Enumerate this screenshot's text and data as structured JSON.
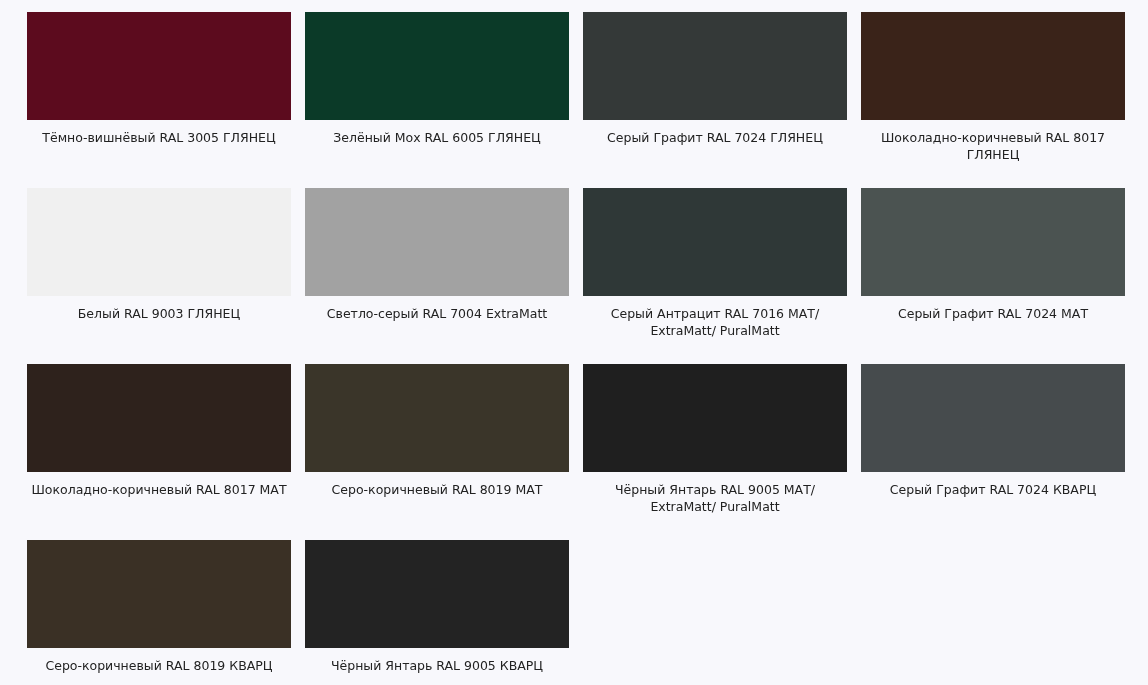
{
  "swatches": [
    {
      "label": "Тёмно-вишнёвый RAL 3005 ГЛЯНЕЦ",
      "color": "#5c0b1e"
    },
    {
      "label": "Зелёный Мох RAL 6005 ГЛЯНЕЦ",
      "color": "#0b3a28"
    },
    {
      "label": "Серый Графит RAL 7024 ГЛЯНЕЦ",
      "color": "#343938"
    },
    {
      "label": "Шоколадно-коричневый RAL 8017 ГЛЯНЕЦ",
      "color": "#3a2319"
    },
    {
      "label": "Белый RAL 9003 ГЛЯНЕЦ",
      "color": "#f0f0f0"
    },
    {
      "label": "Светло-серый RAL 7004 ExtraMatt",
      "color": "#a2a2a2"
    },
    {
      "label": "Серый Антрацит RAL 7016 МАТ/ ExtraMatt/ PuralMatt",
      "color": "#2f3837"
    },
    {
      "label": "Серый Графит RAL 7024 МАТ",
      "color": "#4b5351"
    },
    {
      "label": "Шоколадно-коричневый RAL 8017 МАТ",
      "color": "#2e221c"
    },
    {
      "label": "Серо-коричневый RAL 8019 МАТ",
      "color": "#3a3529"
    },
    {
      "label": "Чёрный Янтарь RAL 9005 МАТ/ ExtraMatt/ PuralMatt",
      "color": "#1f1f1f"
    },
    {
      "label": "Серый Графит RAL 7024 КВАРЦ",
      "color": "#464b4d"
    },
    {
      "label": "Серо-коричневый RAL 8019 КВАРЦ",
      "color": "#3a3025"
    },
    {
      "label": "Чёрный Янтарь RAL 9005 КВАРЦ",
      "color": "#232323"
    }
  ]
}
